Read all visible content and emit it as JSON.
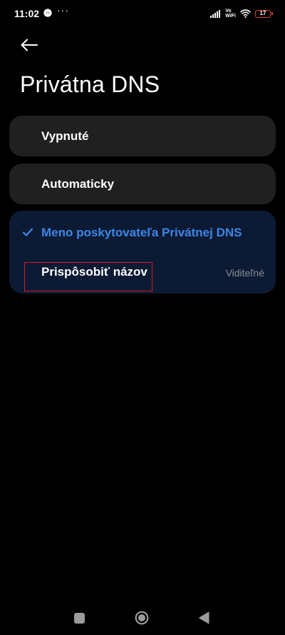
{
  "status_bar": {
    "time": "11:02",
    "more_indicator": "···",
    "network_line1": "Vo",
    "network_line2": "WiFi",
    "battery_level": "17",
    "colors": {
      "battery_low": "#e0402f"
    }
  },
  "header": {
    "back_icon": "arrow-left-icon",
    "title": "Privátna DNS"
  },
  "options": {
    "off_label": "Vypnuté",
    "auto_label": "Automaticky",
    "provider_label": "Meno poskytovateľa Privátnej DNS",
    "provider_selected": true,
    "custom_name_label": "Prispôsobiť názov",
    "visibility_value": "Viditeľné"
  },
  "colors": {
    "background": "#000000",
    "card": "#202020",
    "selected_card": "#0c1a33",
    "accent": "#3d86e8",
    "secondary_text": "#8a8f98",
    "highlight_border": "#d21f25"
  },
  "nav_bar": {
    "recents_icon": "square-icon",
    "home_icon": "circle-icon",
    "back_icon": "triangle-back-icon"
  }
}
